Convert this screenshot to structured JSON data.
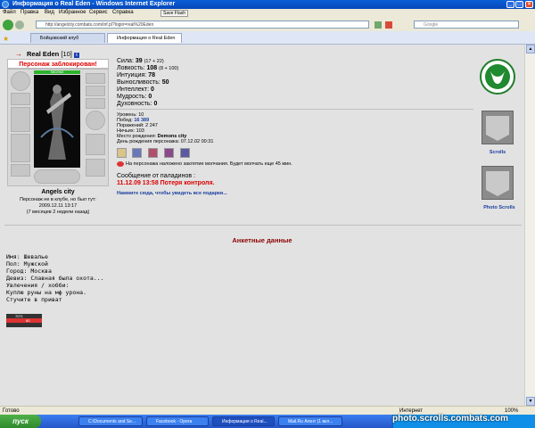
{
  "window": {
    "title": "Информация о Real Eden - Windows Internet Explorer"
  },
  "menu": {
    "items": [
      "Файл",
      "Правка",
      "Вид",
      "Избранное",
      "Сервис",
      "Справка"
    ],
    "save_flash": "Save Flash"
  },
  "address": {
    "url": "http://angelcity.combats.com/inf.pl?login=real%20Eden",
    "search_placeholder": "Google"
  },
  "tabs": [
    {
      "label": "Бойцовский клуб"
    },
    {
      "label": "Информация о Real Eden"
    }
  ],
  "character": {
    "name": "Real Eden",
    "level": "[10]",
    "blocked": "Персонаж заблокирован!",
    "hp": "960/960",
    "city": "Angels city",
    "not_in_club": "Персонаж не в клубе, но был тут:",
    "last_seen": "2009.12.11 13:17",
    "ago": "(7 месяцев 2 недели назад)"
  },
  "stats": [
    {
      "label": "Сила:",
      "value": "39",
      "extra": "(17 + 22)"
    },
    {
      "label": "Ловкость:",
      "value": "108",
      "extra": "(8 + 100)"
    },
    {
      "label": "Интуиция:",
      "value": "78",
      "extra": ""
    },
    {
      "label": "Выносливость:",
      "value": "50",
      "extra": ""
    },
    {
      "label": "Интеллект:",
      "value": "0",
      "extra": ""
    },
    {
      "label": "Мудрость:",
      "value": "0",
      "extra": ""
    },
    {
      "label": "Духовность:",
      "value": "0",
      "extra": ""
    }
  ],
  "info": {
    "level": "Уровень: 10",
    "wins_label": "Побед: ",
    "wins": "16 389",
    "losses": "Поражений: 2 247",
    "draws": "Ничьих: 103",
    "birthplace_label": "Место рождения: ",
    "birthplace": "Demons city",
    "birthday": "День рождения персонажа: 07.12.02 00:31",
    "silence": "На персонажа наложено заклятие молчания. Будет молчать еще 45 мин."
  },
  "paladins": {
    "title": "Сообщение от паладинов :",
    "message": "11.12.09 13:58 Потеря контроля."
  },
  "gift_link": "Нажмите сюда, чтобы увидеть все подарки...",
  "side": {
    "scrolls": "Scrolls",
    "photo_scrolls": "Photo Scrolls"
  },
  "anketa": {
    "title": "Анкетные данные",
    "lines": [
      "Имя: Шевалье",
      "Пол: Мужской",
      "Город: Москва",
      "Девиз: Славная была охота...",
      "Увлечения / хобби:",
      "Куплю руны на мф урона.",
      "Стучите в приват"
    ]
  },
  "counter": {
    "line1": "7071",
    "line2": "80"
  },
  "statusbar": {
    "left": "Готово",
    "zone": "Интернет",
    "zoom": "100%"
  },
  "taskbar": {
    "start": "пуск",
    "items": [
      "C:\\Documents and Se...",
      "Facebook - Opera",
      "Информация о Real...",
      "Mail.Ru Агент (1 вкл..."
    ]
  },
  "watermark": "photo.scrolls.combats.com"
}
